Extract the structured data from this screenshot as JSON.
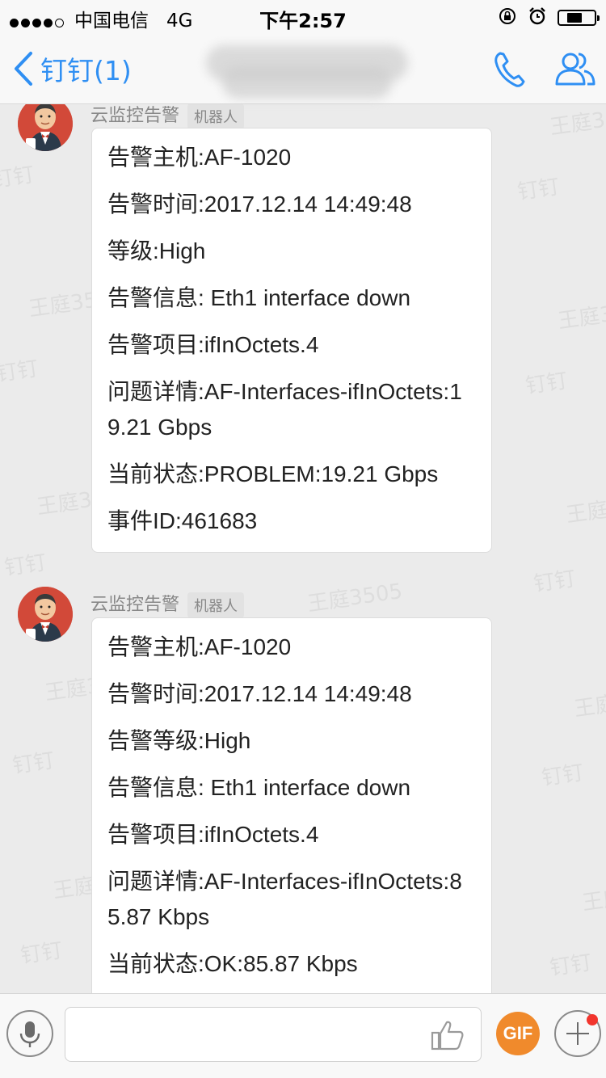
{
  "status_bar": {
    "carrier": "中国电信",
    "network": "4G",
    "time": "下午2:57",
    "battery_level": 0.45
  },
  "nav": {
    "back_label": "钉钉(1)"
  },
  "watermark": "王庭3505",
  "watermark_app": "钉钉",
  "messages": [
    {
      "sender": "云监控告警",
      "tag": "机器人",
      "lines": [
        "告警主机:AF-1020",
        "告警时间:2017.12.14 14:49:48",
        "等级:High",
        "告警信息: Eth1 interface down",
        "告警项目:ifInOctets.4",
        "问题详情:AF-Interfaces-ifInOctets:19.21 Gbps",
        "当前状态:PROBLEM:19.21 Gbps",
        "事件ID:461683"
      ]
    },
    {
      "sender": "云监控告警",
      "tag": "机器人",
      "lines": [
        "告警主机:AF-1020",
        "告警时间:2017.12.14 14:49:48",
        "告警等级:High",
        "告警信息: Eth1 interface down",
        "告警项目:ifInOctets.4",
        "问题详情:AF-Interfaces-ifInOctets:85.87 Kbps",
        "当前状态:OK:85.87 Kbps"
      ]
    }
  ],
  "input_bar": {
    "gif_label": "GIF",
    "input_placeholder": ""
  },
  "colors": {
    "accent": "#2f8ff3",
    "gif": "#f08a2c",
    "badge": "#f2352d"
  }
}
